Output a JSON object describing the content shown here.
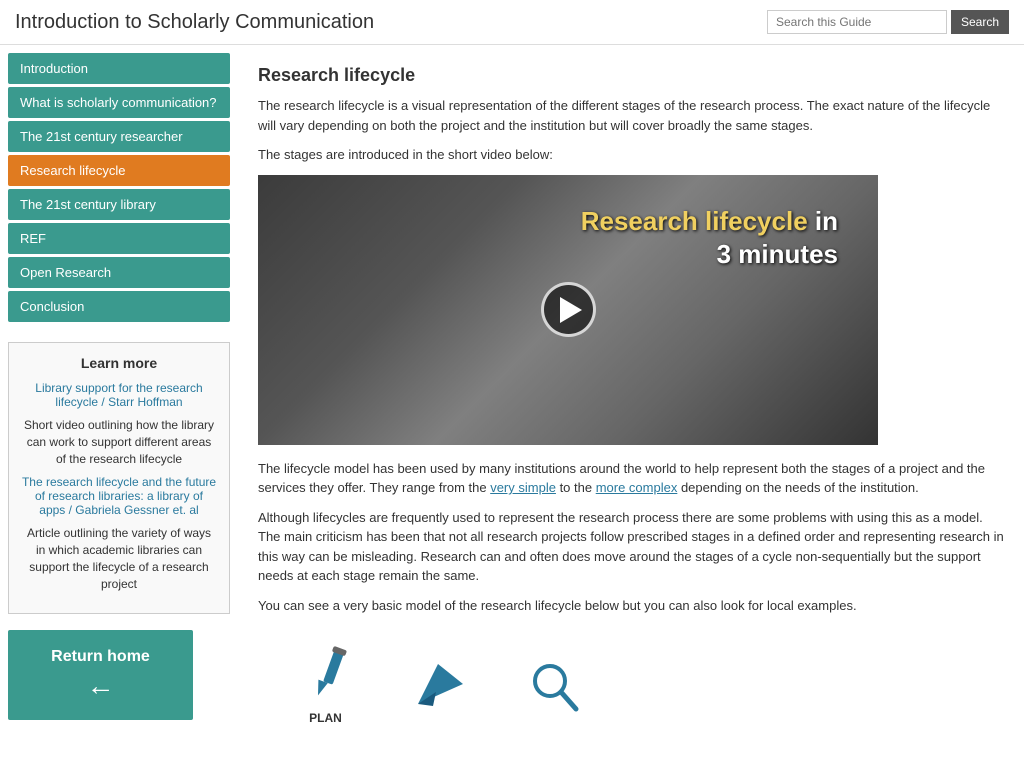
{
  "header": {
    "title": "Introduction to Scholarly Communication",
    "search_placeholder": "Search this Guide",
    "search_label": "Search"
  },
  "sidebar": {
    "nav_items": [
      {
        "id": "introduction",
        "label": "Introduction",
        "active": false
      },
      {
        "id": "what-is-scholarly",
        "label": "What is scholarly communication?",
        "active": false
      },
      {
        "id": "21st-century-researcher",
        "label": "The 21st century researcher",
        "active": false
      },
      {
        "id": "research-lifecycle",
        "label": "Research lifecycle",
        "active": true
      },
      {
        "id": "21st-century-library",
        "label": "The 21st century library",
        "active": false
      },
      {
        "id": "ref",
        "label": "REF",
        "active": false
      },
      {
        "id": "open-research",
        "label": "Open Research",
        "active": false
      },
      {
        "id": "conclusion",
        "label": "Conclusion",
        "active": false
      }
    ],
    "learn_more": {
      "title": "Learn more",
      "items": [
        {
          "type": "link",
          "text": "Library support for the research lifecycle / Starr Hoffman"
        },
        {
          "type": "text",
          "text": "Short video outlining how the library can work to support different areas of the research lifecycle"
        },
        {
          "type": "link",
          "text": "The research lifecycle and the future of research libraries: a library of apps / Gabriela Gessner et. al"
        },
        {
          "type": "text",
          "text": "Article outlining the variety of ways in which academic libraries can support the lifecycle of a research project"
        }
      ]
    },
    "return_home": "Return home"
  },
  "content": {
    "title": "Research lifecycle",
    "para1": "The research lifecycle is a visual representation of the different stages of the research process. The exact nature of the lifecycle will vary depending on both the project and the institution but will cover broadly the same stages.",
    "para2": "The stages are introduced in the short video below:",
    "video_title_part1": "Research lifecycle",
    "video_title_part2": " in",
    "video_title_part3": "3 minutes",
    "para3_before": "The lifecycle model has been used by many institutions around the world to help represent both the stages of a project and the services they offer. They range from the ",
    "link_simple": "very simple",
    "para3_mid": " to the ",
    "link_complex": "more complex",
    "para3_after": " depending on the needs of the institution.",
    "para4": "Although lifecycles are frequently used to represent the research process there are some problems with using this as a model. The main criticism has been that not all research projects follow prescribed stages in a defined order and representing research in this way can be misleading. Research can and often does move around the stages of a cycle non-sequentially but the support needs at each stage remain the same.",
    "para5": "You can see a very basic model of the research lifecycle below but you can also look for local examples.",
    "lifecycle_icons": [
      {
        "id": "plan",
        "label": "PLAN",
        "icon": "pencil"
      },
      {
        "id": "communicate",
        "label": "",
        "icon": "paper-plane"
      },
      {
        "id": "discover",
        "label": "",
        "icon": "magnifier"
      }
    ]
  }
}
